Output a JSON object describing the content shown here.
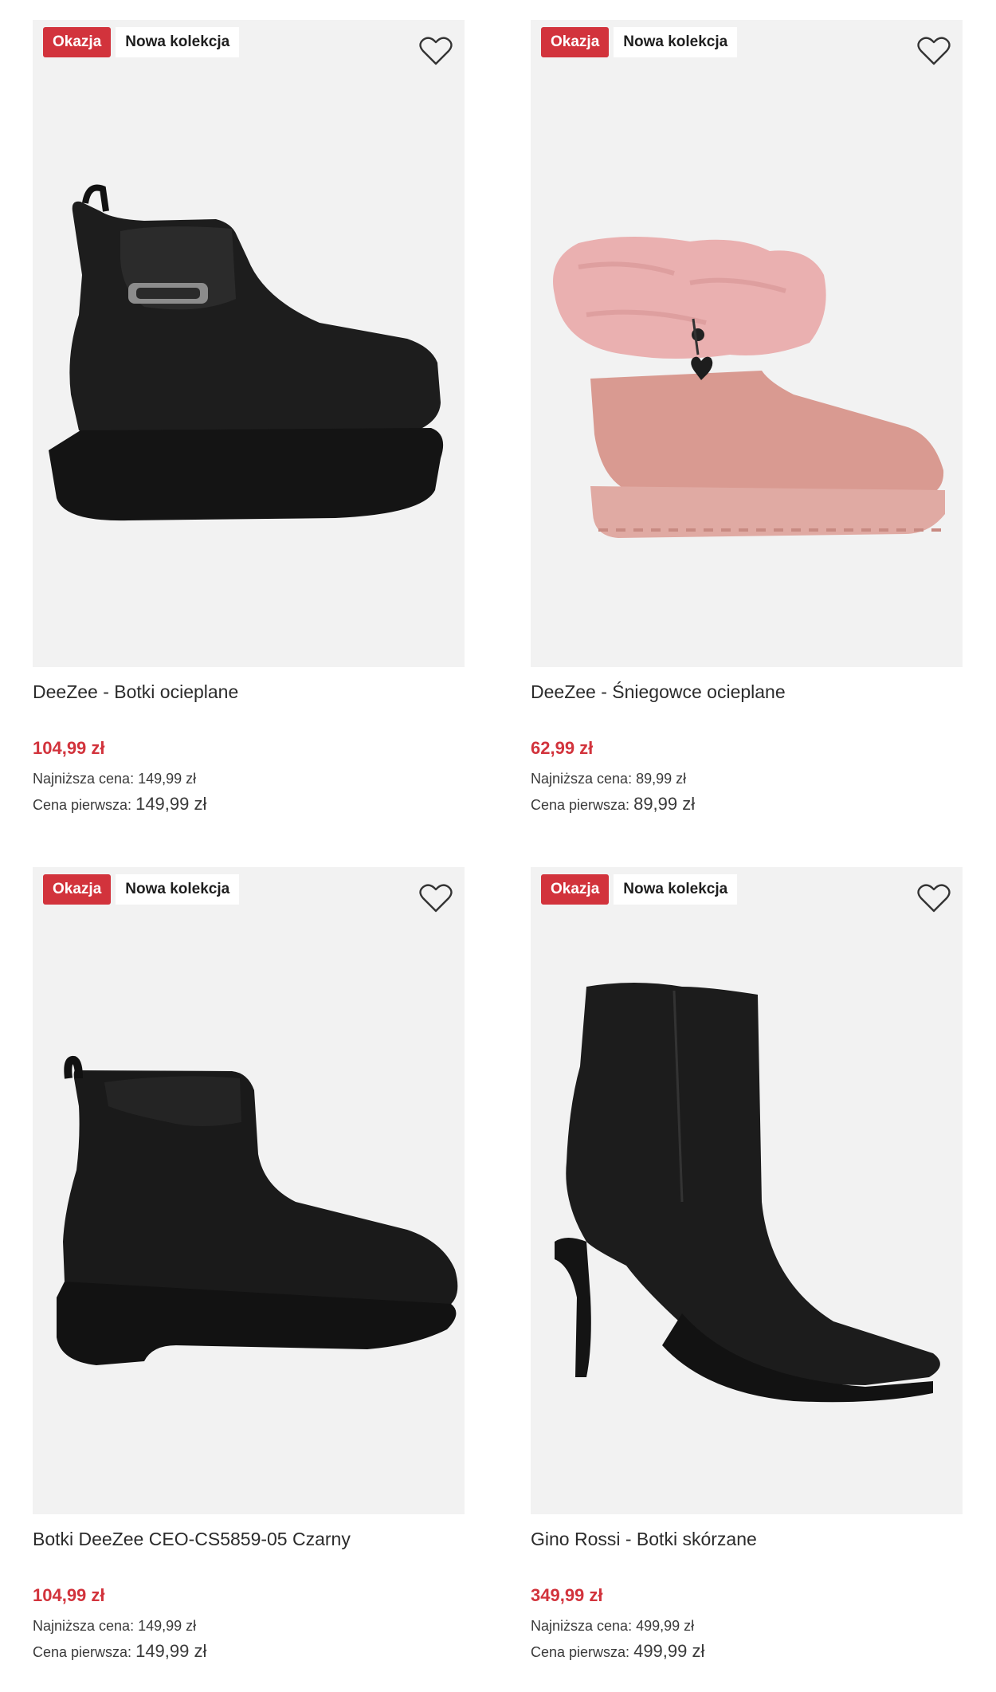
{
  "colors": {
    "sale": "#d2333c",
    "image_bg": "#f2f2f2"
  },
  "products": [
    {
      "badge_deal": "Okazja",
      "badge_new": "Nowa kolekcja",
      "name": "DeeZee - Botki ocieplane",
      "price": "104,99 zł",
      "lowest_label": "Najniższa cena:",
      "lowest_value": "149,99 zł",
      "first_label": "Cena pierwsza:",
      "first_value": "149,99 zł",
      "image": "black-platform-chelsea-boot"
    },
    {
      "badge_deal": "Okazja",
      "badge_new": "Nowa kolekcja",
      "name": "DeeZee - Śniegowce ocieplane",
      "price": "62,99 zł",
      "lowest_label": "Najniższa cena:",
      "lowest_value": "89,99 zł",
      "first_label": "Cena pierwsza:",
      "first_value": "89,99 zł",
      "image": "pink-fur-snow-boot"
    },
    {
      "badge_deal": "Okazja",
      "badge_new": "Nowa kolekcja",
      "name": "Botki DeeZee CEO-CS5859-05 Czarny",
      "price": "104,99 zł",
      "lowest_label": "Najniższa cena:",
      "lowest_value": "149,99 zł",
      "first_label": "Cena pierwsza:",
      "first_value": "149,99 zł",
      "image": "black-suede-heeled-ankle-boot"
    },
    {
      "badge_deal": "Okazja",
      "badge_new": "Nowa kolekcja",
      "name": "Gino Rossi - Botki skórzane",
      "price": "349,99 zł",
      "lowest_label": "Najniższa cena:",
      "lowest_value": "499,99 zł",
      "first_label": "Cena pierwsza:",
      "first_value": "499,99 zł",
      "image": "black-leather-stiletto-ankle-boot"
    }
  ]
}
